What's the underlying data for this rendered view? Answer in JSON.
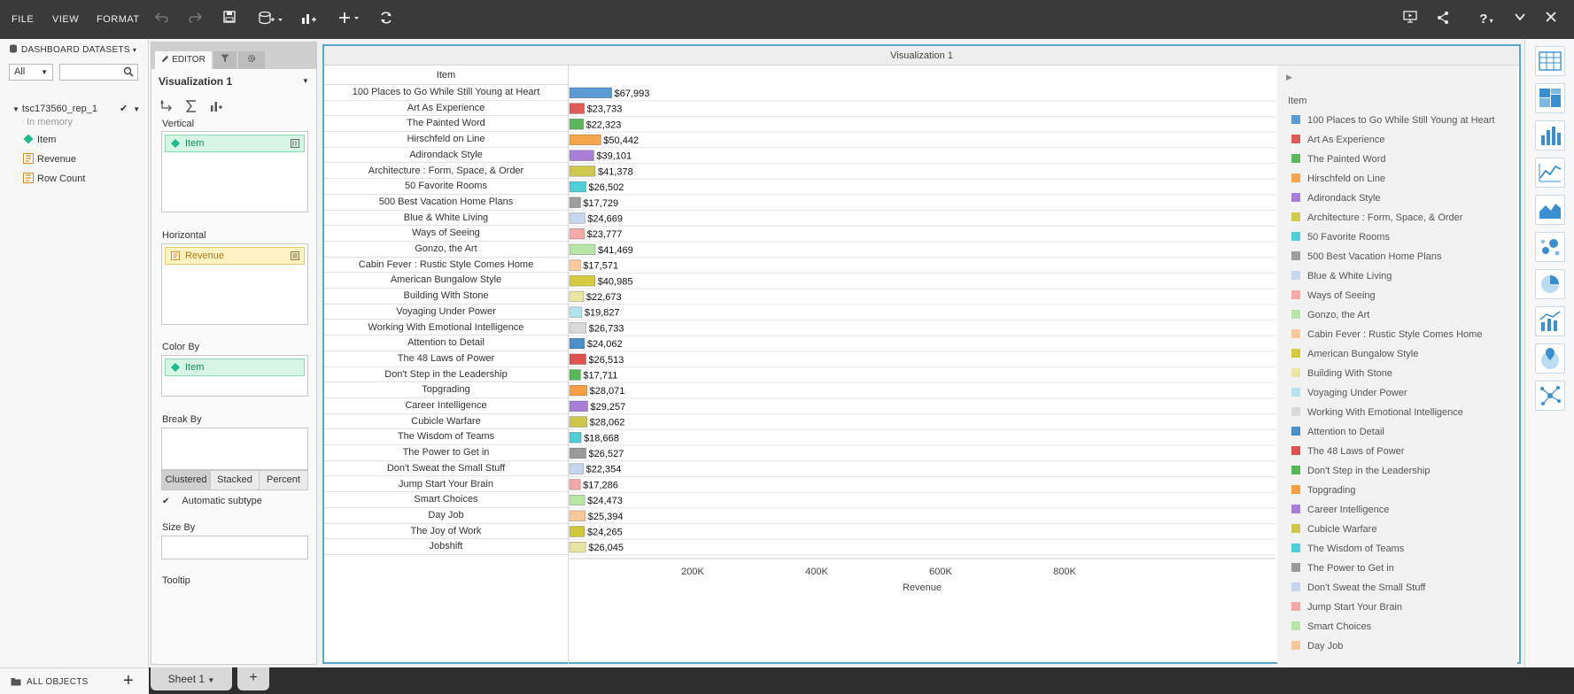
{
  "toolbar": {
    "menu": [
      "FILE",
      "VIEW",
      "FORMAT"
    ]
  },
  "datasets": {
    "header": "DASHBOARD DATASETS",
    "filter_value": "All",
    "search_placeholder": "",
    "dataset_name": "tsc173560_rep_1",
    "dataset_status": "In memory",
    "attributes": [
      "Item"
    ],
    "metrics": [
      "Revenue",
      "Row Count"
    ]
  },
  "bottom": {
    "all_objects": "ALL OBJECTS",
    "sheet_tab": "Sheet 1"
  },
  "editor": {
    "tabs": [
      "EDITOR"
    ],
    "viz_name": "Visualization 1",
    "vertical_label": "Vertical",
    "vertical_item": "Item",
    "horizontal_label": "Horizontal",
    "horizontal_item": "Revenue",
    "color_by_label": "Color By",
    "color_by_item": "Item",
    "break_by_label": "Break By",
    "subtypes": [
      "Clustered",
      "Stacked",
      "Percent"
    ],
    "auto_subtype": "Automatic subtype",
    "size_by_label": "Size By",
    "tooltip_label": "Tooltip"
  },
  "viz": {
    "title": "Visualization 1",
    "column_header": "Item",
    "legend_title": "Item"
  },
  "chart_data": {
    "type": "bar",
    "orientation": "horizontal",
    "categories": [
      "100 Places to Go While Still Young at Heart",
      "Art As Experience",
      "The Painted Word",
      "Hirschfeld on Line",
      "Adirondack Style",
      "Architecture : Form, Space, & Order",
      "50 Favorite Rooms",
      "500 Best Vacation Home Plans",
      "Blue & White Living",
      "Ways of Seeing",
      "Gonzo, the Art",
      "Cabin Fever : Rustic Style Comes Home",
      "American Bungalow Style",
      "Building With Stone",
      "Voyaging Under Power",
      "Working With Emotional Intelligence",
      "Attention to Detail",
      "The 48 Laws of Power",
      "Don't Step in the Leadership",
      "Topgrading",
      "Career Intelligence",
      "Cubicle Warfare",
      "The Wisdom of Teams",
      "The Power to Get in",
      "Don't Sweat the Small Stuff",
      "Jump Start Your Brain",
      "Smart Choices",
      "Day Job",
      "The Joy of Work",
      "Jobshift"
    ],
    "values": [
      67993,
      23733,
      22323,
      50442,
      39101,
      41378,
      26502,
      17729,
      24669,
      23777,
      41469,
      17571,
      40985,
      22673,
      19827,
      26733,
      24062,
      26513,
      17711,
      28071,
      29257,
      28062,
      18668,
      26527,
      22354,
      17286,
      24473,
      25394,
      24265,
      26045
    ],
    "value_labels": [
      "$67,993",
      "$23,733",
      "$22,323",
      "$50,442",
      "$39,101",
      "$41,378",
      "$26,502",
      "$17,729",
      "$24,669",
      "$23,777",
      "$41,469",
      "$17,571",
      "$40,985",
      "$22,673",
      "$19,827",
      "$26,733",
      "$24,062",
      "$26,513",
      "$17,711",
      "$28,071",
      "$29,257",
      "$28,062",
      "$18,668",
      "$26,527",
      "$22,354",
      "$17,286",
      "$24,473",
      "$25,394",
      "$24,265",
      "$26,045"
    ],
    "colors": [
      "#5b9bd5",
      "#e05a5a",
      "#5cb85c",
      "#f7a54a",
      "#a97ed6",
      "#cfc94e",
      "#4fd0d8",
      "#9e9e9e",
      "#c5d6ef",
      "#f6aaaa",
      "#b8e6a8",
      "#f9c99c",
      "#d4cb3e",
      "#e9e6a6",
      "#b4e3ee",
      "#d9d9d9",
      "#4a8fc7",
      "#e05252",
      "#57b857",
      "#f7a043",
      "#a77fd7",
      "#cdc84b",
      "#4dcfd8",
      "#9a9a9a",
      "#c6d5ef",
      "#f6a8a8",
      "#b7e6a6",
      "#f8c79a",
      "#d2c83c",
      "#e8e5a4"
    ],
    "legend_items": [
      "100 Places to Go While Still Young at Heart",
      "Art As Experience",
      "The Painted Word",
      "Hirschfeld on Line",
      "Adirondack Style",
      "Architecture : Form, Space, & Order",
      "50 Favorite Rooms",
      "500 Best Vacation Home Plans",
      "Blue & White Living",
      "Ways of Seeing",
      "Gonzo, the Art",
      "Cabin Fever : Rustic Style Comes Home",
      "American Bungalow Style",
      "Building With Stone",
      "Voyaging Under Power",
      "Working With Emotional Intelligence",
      "Attention to Detail",
      "The 48 Laws of Power",
      "Don't Step in the Leadership",
      "Topgrading",
      "Career Intelligence",
      "Cubicle Warfare",
      "The Wisdom of Teams",
      "The Power to Get in",
      "Don't Sweat the Small Stuff",
      "Jump Start Your Brain",
      "Smart Choices",
      "Day Job"
    ],
    "xlabel": "Revenue",
    "xticks": [
      {
        "value": 200000,
        "label": "200K"
      },
      {
        "value": 400000,
        "label": "400K"
      },
      {
        "value": 600000,
        "label": "600K"
      },
      {
        "value": 800000,
        "label": "800K"
      }
    ],
    "xlim": [
      0,
      1000000
    ],
    "grid": false,
    "legend_position": "right"
  },
  "gallery": {
    "icons": [
      "grid-icon",
      "heat-map-icon",
      "bar-chart-icon",
      "line-chart-icon",
      "area-chart-icon",
      "bubble-chart-icon",
      "pie-chart-icon",
      "combo-chart-icon",
      "map-icon",
      "network-icon"
    ]
  }
}
